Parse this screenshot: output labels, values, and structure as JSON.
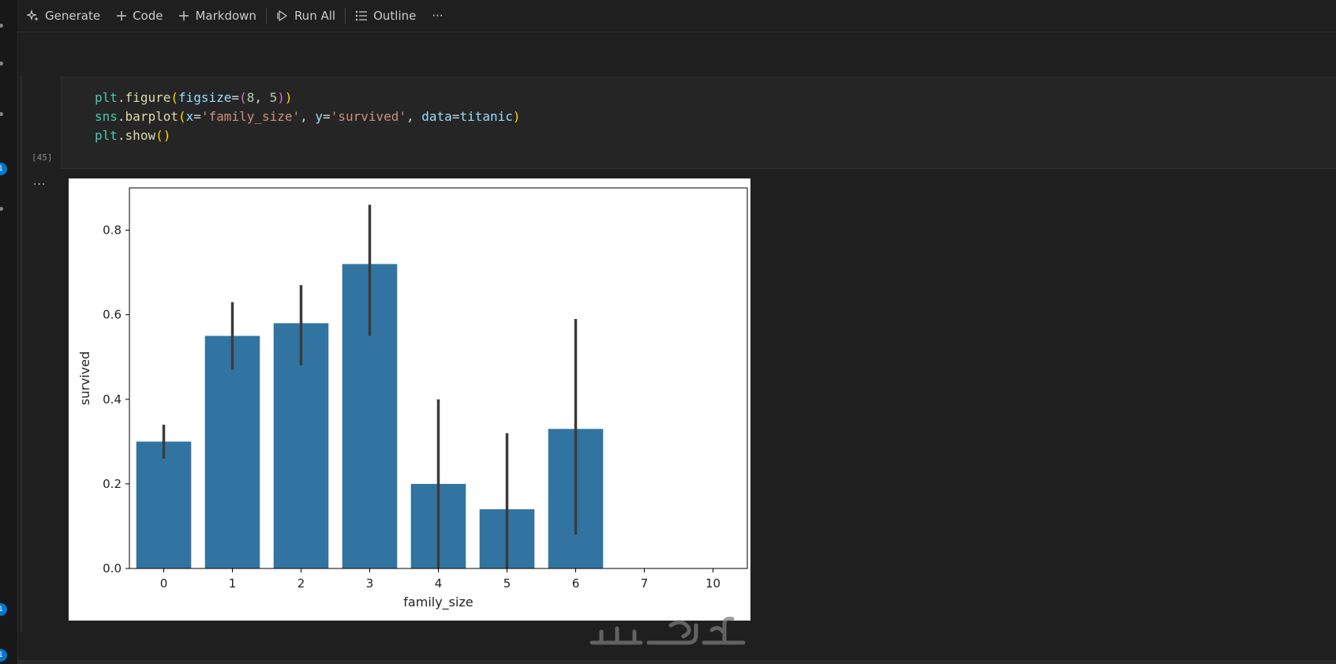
{
  "toolbar": {
    "generate_label": "Generate",
    "code_label": "Code",
    "markdown_label": "Markdown",
    "run_all_label": "Run All",
    "outline_label": "Outline",
    "more_label": "···"
  },
  "cell": {
    "execution_count": "[45]",
    "output_menu": "···",
    "code": {
      "line1": {
        "obj": "plt",
        "dot": ".",
        "fn": "figure",
        "open": "(",
        "param": "figsize",
        "eq": "=",
        "open2": "(",
        "num1": "8",
        "comma": ", ",
        "num2": "5",
        "close2": ")",
        "close": ")"
      },
      "line2": {
        "obj": "sns",
        "dot": ".",
        "fn": "barplot",
        "open": "(",
        "p1": "x",
        "eq1": "=",
        "s1": "'family_size'",
        "c1": ", ",
        "p2": "y",
        "eq2": "=",
        "s2": "'survived'",
        "c2": ", ",
        "p3": "data",
        "eq3": "=",
        "v3": "titanic",
        "close": ")"
      },
      "line3": {
        "obj": "plt",
        "dot": ".",
        "fn": "show",
        "parens": "()"
      }
    }
  },
  "chart_data": {
    "type": "bar",
    "categories": [
      "0",
      "1",
      "2",
      "3",
      "4",
      "5",
      "6",
      "7",
      "10"
    ],
    "values": [
      0.3,
      0.55,
      0.58,
      0.72,
      0.2,
      0.14,
      0.33,
      0.0,
      0.0
    ],
    "error_low": [
      0.26,
      0.47,
      0.48,
      0.55,
      0.0,
      0.0,
      0.08,
      null,
      null
    ],
    "error_high": [
      0.34,
      0.63,
      0.67,
      0.86,
      0.4,
      0.32,
      0.59,
      null,
      null
    ],
    "xlabel": "family_size",
    "ylabel": "survived",
    "ylim": [
      0,
      0.9
    ],
    "yticks": [
      0.0,
      0.2,
      0.4,
      0.6,
      0.8
    ],
    "ytick_labels": [
      "0.0",
      "0.2",
      "0.4",
      "0.6",
      "0.8"
    ],
    "bar_color": "#3274a1",
    "error_color": "#3b3b3b",
    "grid": false
  },
  "colors": {
    "editor_bg": "#1f1f1f",
    "cell_bg": "#252526",
    "accent_badge": "#0078d4"
  },
  "watermark": {
    "icon": "khamsat-logo-icon"
  }
}
